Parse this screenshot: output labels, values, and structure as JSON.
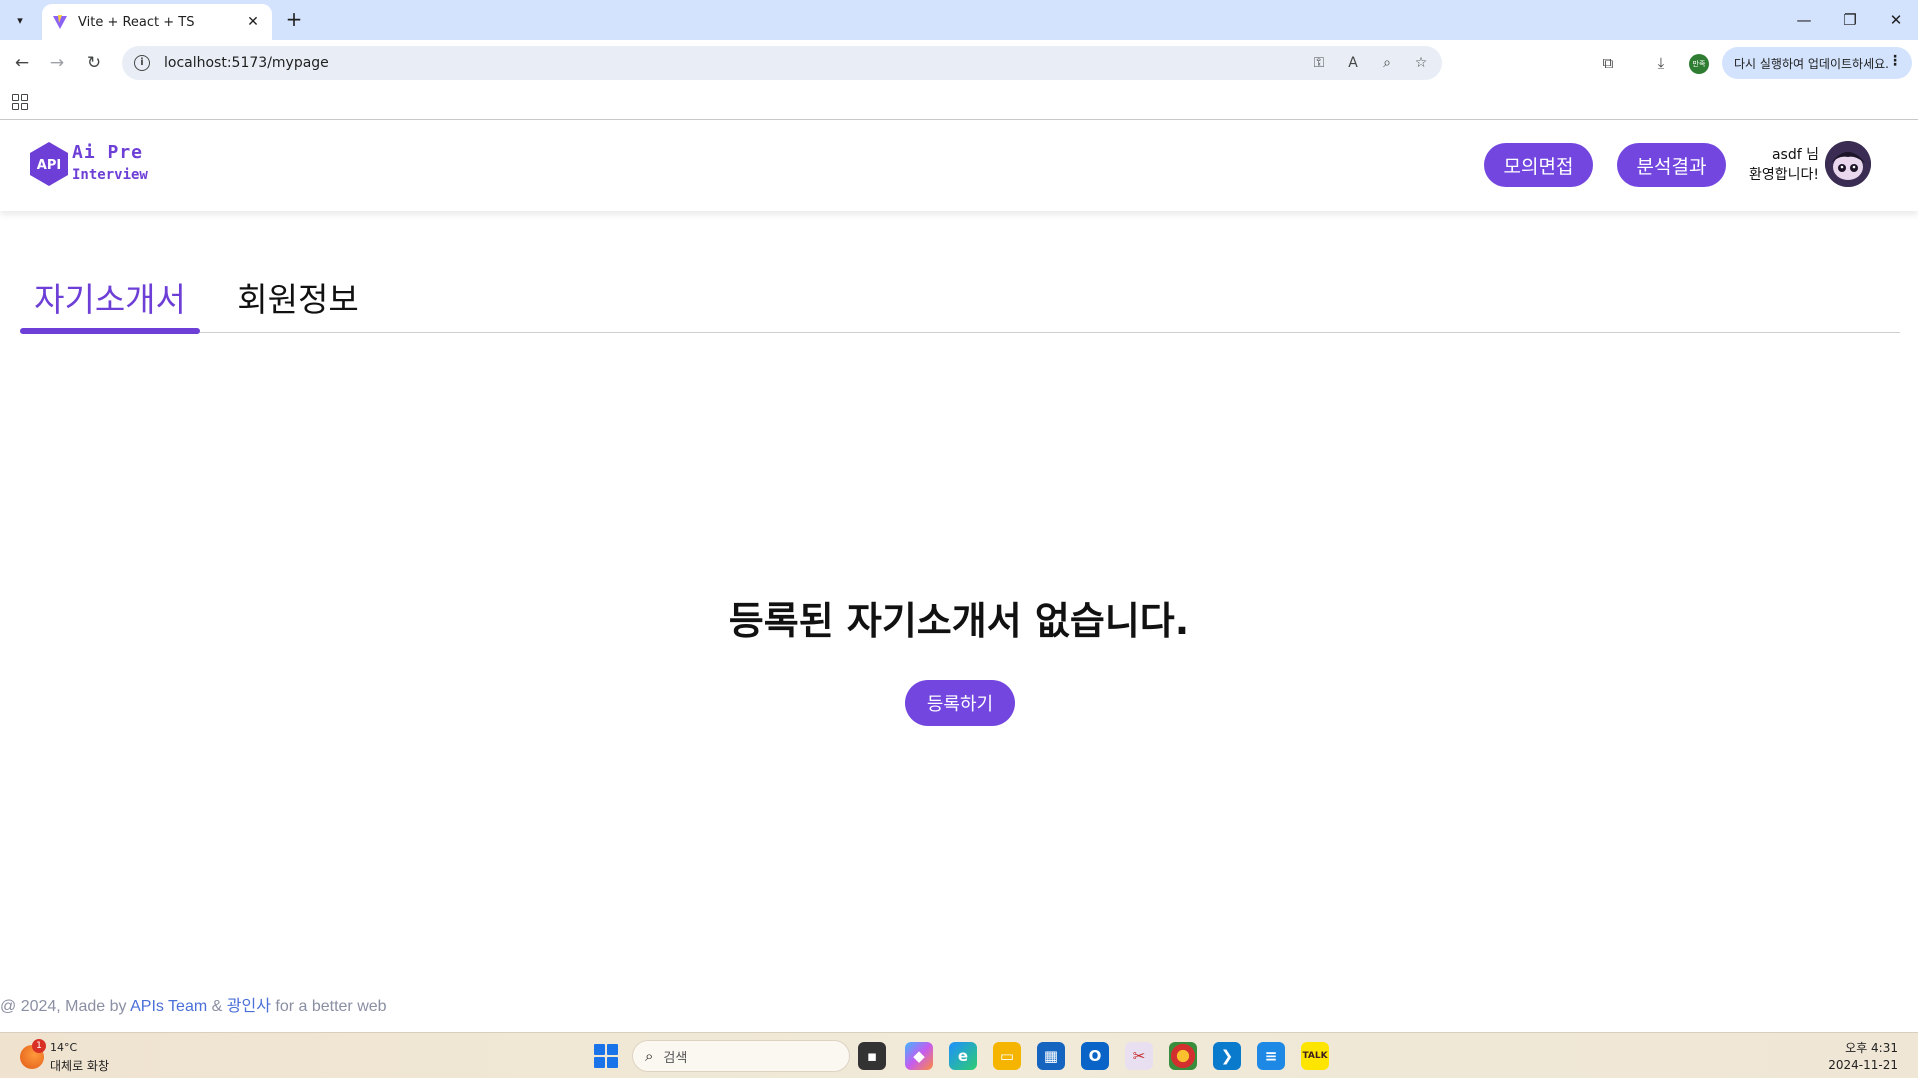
{
  "browser": {
    "tab_title": "Vite + React + TS",
    "url": "localhost:5173/mypage",
    "update_label": "다시 실행하여 업데이트하세요.",
    "profile_label": "만족"
  },
  "site": {
    "logo_badge": "API",
    "logo_line1": "Ai Pre",
    "logo_line2": "Interview",
    "nav": {
      "mock_interview": "모의면접",
      "analysis_result": "분석결과"
    },
    "welcome_user": "asdf 님",
    "welcome_text": "환영합니다!"
  },
  "tabs": [
    {
      "label": "자기소개서",
      "active": true
    },
    {
      "label": "회원정보",
      "active": false
    }
  ],
  "main": {
    "empty_message": "등록된 자기소개서 없습니다.",
    "register_label": "등록하기"
  },
  "footer": {
    "prefix": "@ 2024, Made by ",
    "team_link": "APIs Team",
    "amp": " & ",
    "partner_link": "광인사",
    "suffix": " for a better web"
  },
  "taskbar": {
    "weather_badge": "1",
    "temperature": "14°C",
    "weather_desc": "대체로 화창",
    "search_placeholder": "검색",
    "time": "오후 4:31",
    "date": "2024-11-21"
  },
  "colors": {
    "brand": "#7346e0",
    "brand_text": "#6d3fd6",
    "link": "#4b6fd8"
  }
}
